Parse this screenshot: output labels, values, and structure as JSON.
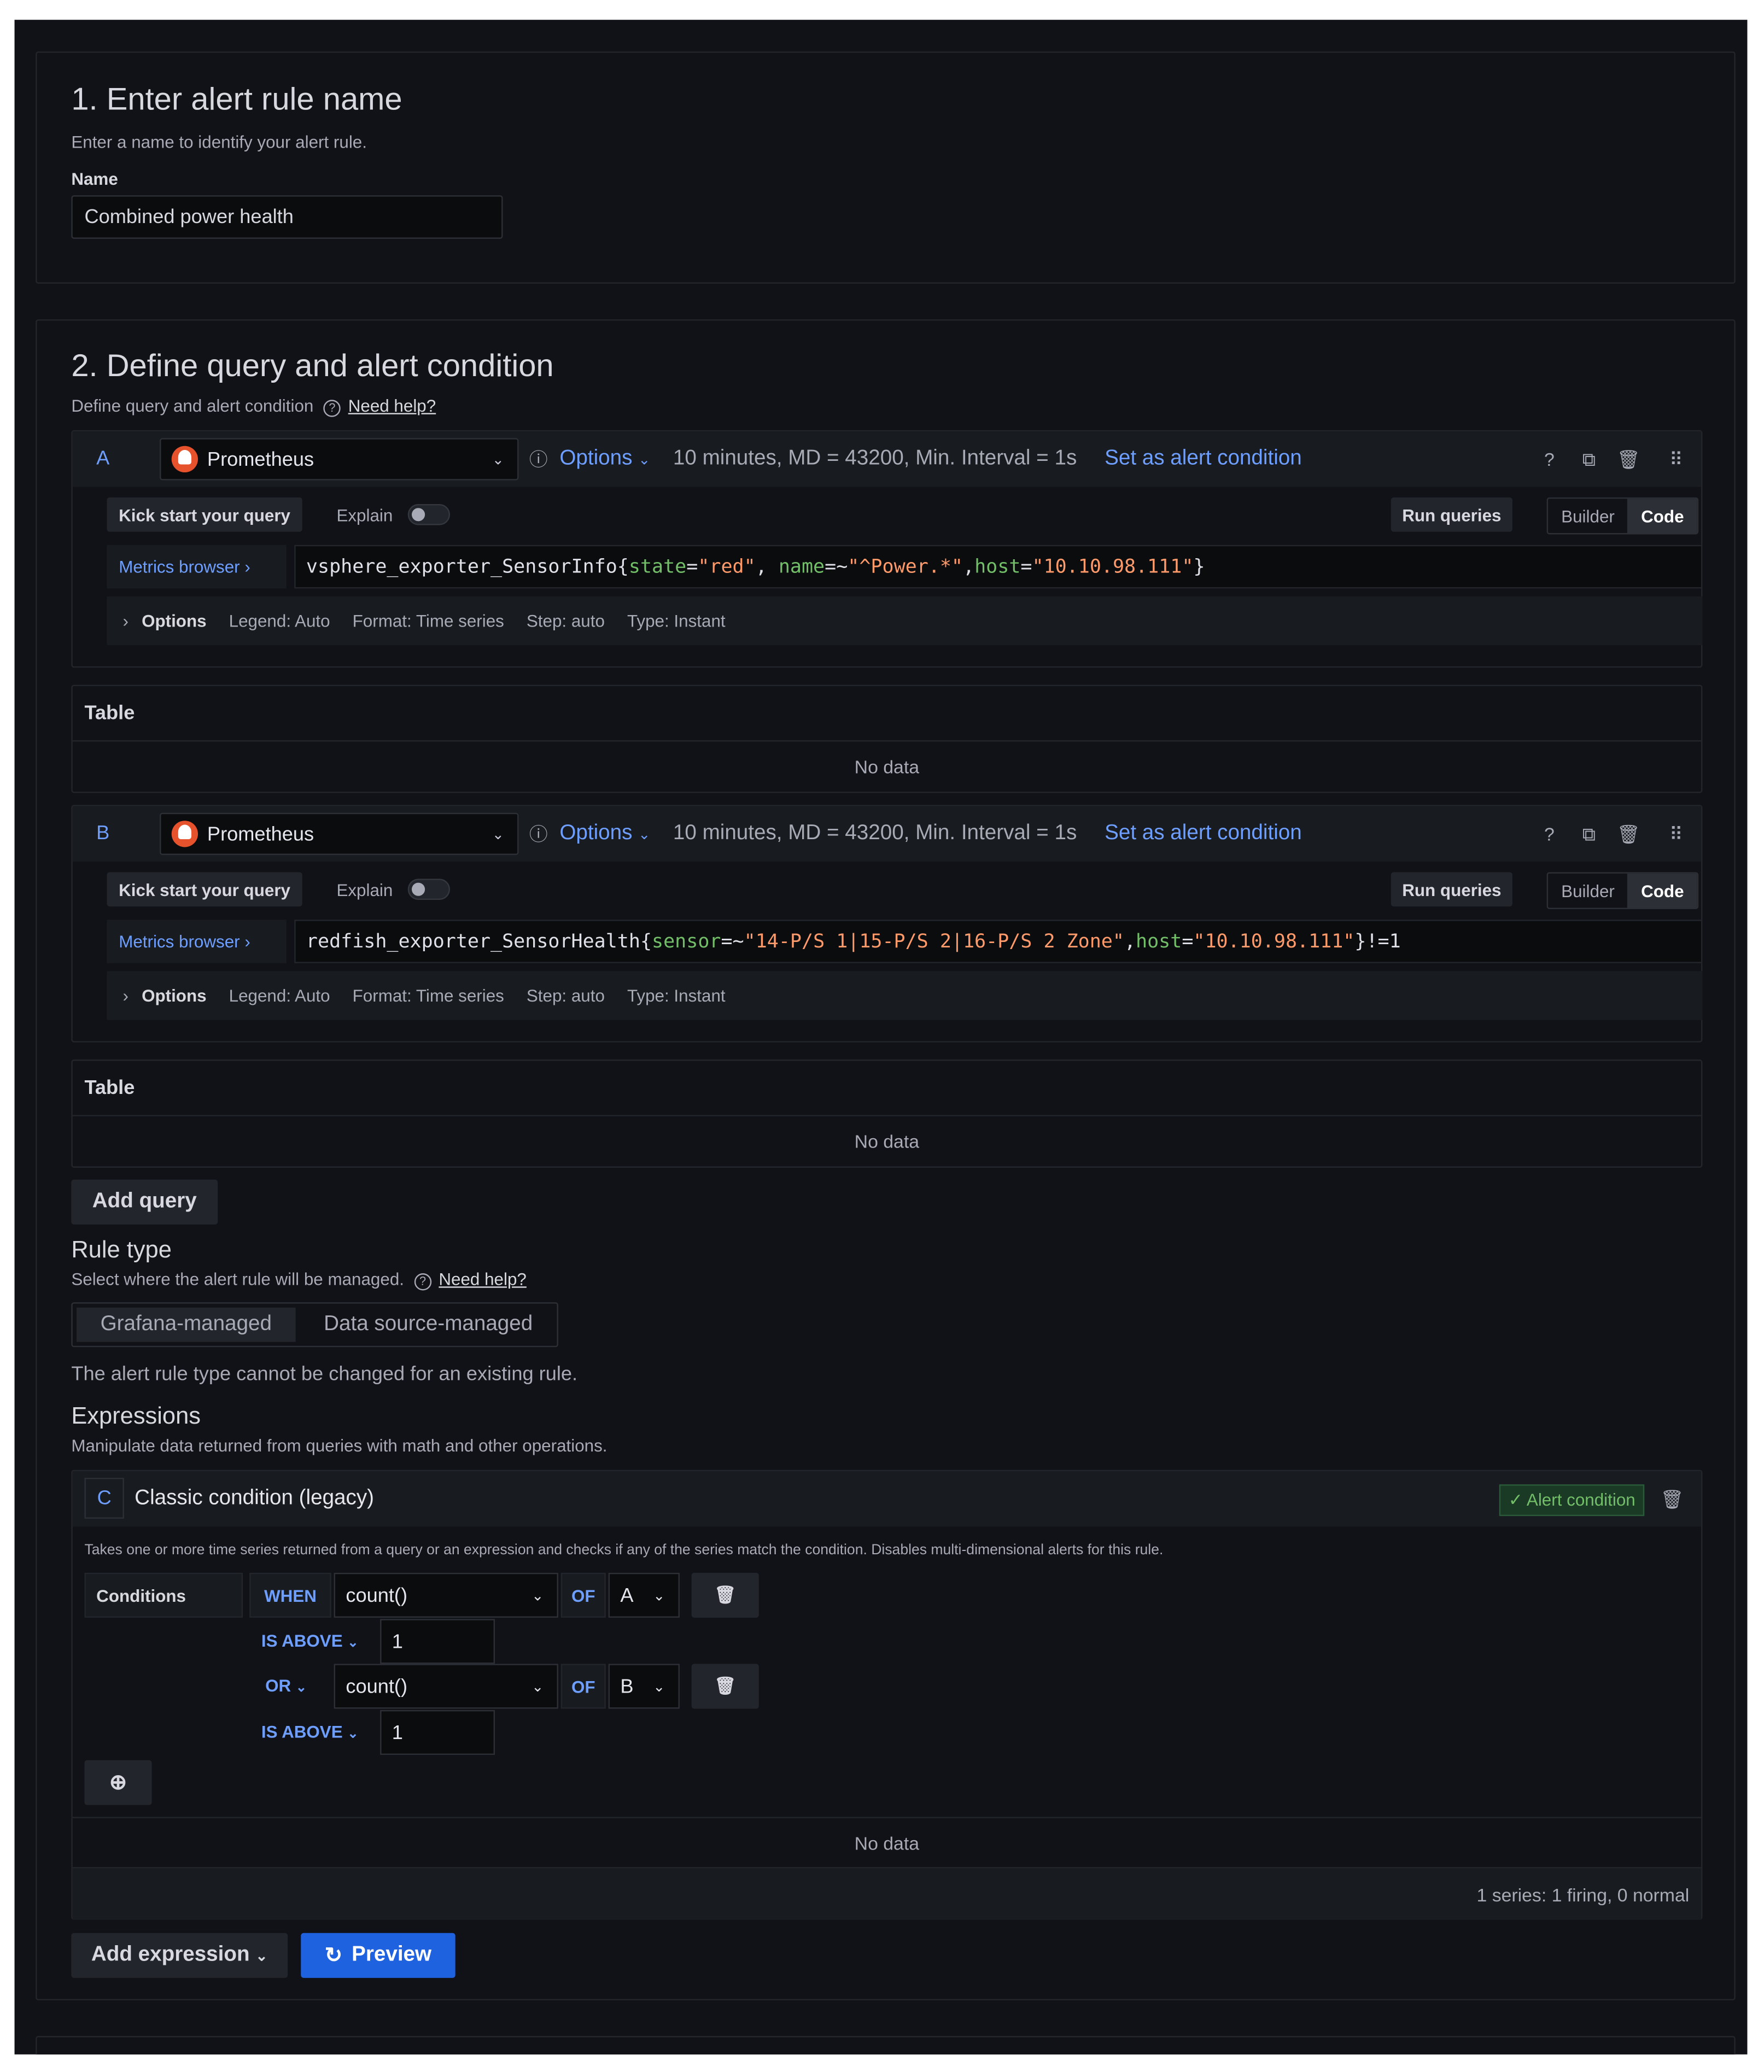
{
  "section1": {
    "title": "1. Enter alert rule name",
    "subtitle": "Enter a name to identify your alert rule.",
    "name_label": "Name",
    "name_value": "Combined power health"
  },
  "section2": {
    "title": "2. Define query and alert condition",
    "subtitle": "Define query and alert condition",
    "need_help": "Need help?",
    "queries": [
      {
        "letter": "A",
        "datasource": "Prometheus",
        "options_label": "Options",
        "options_summary": "10 minutes, MD = 43200, Min. Interval = 1s",
        "set_alert": "Set as alert condition",
        "kick_start": "Kick start your query",
        "explain": "Explain",
        "run_queries": "Run queries",
        "builder": "Builder",
        "code": "Code",
        "metrics_browser": "Metrics browser ›",
        "expr": {
          "metric": "vsphere_exporter_SensorInfo{",
          "l1": "state",
          "op1": "=",
          "v1": "\"red\"",
          "sep1": ", ",
          "l2": "name",
          "op2": "=~",
          "v2": "\"^Power.*\"",
          "sep2": ",",
          "l3": "host",
          "op3": "=",
          "v3": "\"10.10.98.111\"",
          "tail": "}"
        },
        "opt_label": "Options",
        "legend": "Legend: Auto",
        "format": "Format: Time series",
        "step": "Step: auto",
        "type": "Type: Instant",
        "table_title": "Table",
        "no_data": "No data"
      },
      {
        "letter": "B",
        "datasource": "Prometheus",
        "options_label": "Options",
        "options_summary": "10 minutes, MD = 43200, Min. Interval = 1s",
        "set_alert": "Set as alert condition",
        "kick_start": "Kick start your query",
        "explain": "Explain",
        "run_queries": "Run queries",
        "builder": "Builder",
        "code": "Code",
        "metrics_browser": "Metrics browser ›",
        "expr": {
          "metric": "redfish_exporter_SensorHealth{",
          "l1": "sensor",
          "op1": "=~",
          "v1": "\"14-P/S 1|15-P/S 2|16-P/S 2 Zone\"",
          "sep1": ",",
          "l2": "host",
          "op2": "=",
          "v2": "\"10.10.98.111\"",
          "sep2": "",
          "l3": "",
          "op3": "",
          "v3": "",
          "tail": "}!=1"
        },
        "opt_label": "Options",
        "legend": "Legend: Auto",
        "format": "Format: Time series",
        "step": "Step: auto",
        "type": "Type: Instant",
        "table_title": "Table",
        "no_data": "No data"
      }
    ],
    "add_query": "Add query",
    "rule_type": {
      "title": "Rule type",
      "subtitle": "Select where the alert rule will be managed.",
      "need_help": "Need help?",
      "opt1": "Grafana-managed",
      "opt2": "Data source-managed",
      "note": "The alert rule type cannot be changed for an existing rule."
    },
    "expressions": {
      "title": "Expressions",
      "subtitle": "Manipulate data returned from queries with math and other operations.",
      "letter": "C",
      "name": "Classic condition (legacy)",
      "alert_badge": "✓ Alert condition",
      "description": "Takes one or more time series returned from a query or an expression and checks if any of the series match the condition. Disables multi-dimensional alerts for this rule.",
      "conditions_label": "Conditions",
      "when": "WHEN",
      "func1": "count()",
      "of": "OF",
      "query1": "A",
      "is_above": "IS ABOVE",
      "val1": "1",
      "or": "OR",
      "func2": "count()",
      "query2": "B",
      "val2": "1",
      "no_data": "No data",
      "series_summary": "1 series: 1 firing, 0 normal"
    },
    "add_expression": "Add expression",
    "preview": "Preview"
  }
}
